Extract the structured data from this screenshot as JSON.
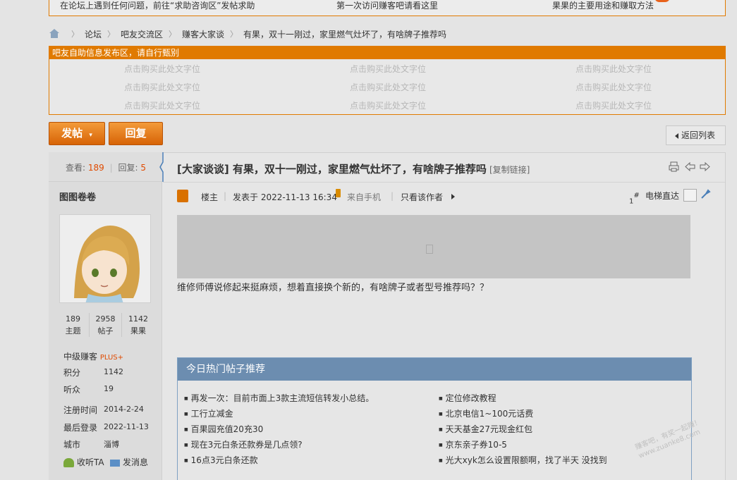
{
  "top_notice": {
    "left": "在论坛上遇到任何问题，前往“求助咨询区”发帖求助",
    "mid": "第一次访问赚客吧请看这里",
    "right": "果果的主要用途和赚取方法",
    "badge": "热"
  },
  "breadcrumb": [
    "论坛",
    "吧友交流区",
    "赚客大家谈",
    "有果，双十一刚过，家里燃气灶坏了，有啥牌子推荐吗"
  ],
  "ad": {
    "header": "吧友自助信息发布区，请自行甄别",
    "slot_text": "点击购买此处文字位"
  },
  "buttons": {
    "post": "发帖",
    "reply": "回复",
    "return": "返回列表"
  },
  "stats": {
    "views_label": "查看:",
    "views": "189",
    "replies_label": "回复:",
    "replies": "5"
  },
  "author": {
    "name": "图图卷卷",
    "counts": [
      {
        "value": "189",
        "label": "主题"
      },
      {
        "value": "2958",
        "label": "帖子"
      },
      {
        "value": "1142",
        "label": "果果"
      }
    ],
    "level": "中级赚客",
    "level_badge": "PLUS+",
    "points_label": "积分",
    "points": "1142",
    "fans_label": "听众",
    "fans": "19",
    "reg_label": "注册时间",
    "reg": "2014-2-24",
    "last_label": "最后登录",
    "last": "2022-11-13",
    "city_label": "城市",
    "city": "淄博",
    "follow": "收听TA",
    "message": "发消息"
  },
  "post": {
    "title": "[大家谈谈] 有果，双十一刚过，家里燃气灶坏了，有啥牌子推荐吗",
    "copy_link": "[复制链接]",
    "owner": "楼主",
    "posted": "发表于 2022-11-13 16:34",
    "source": "来自手机",
    "only_author": "只看该作者",
    "floor": "1",
    "floor_suffix": "#",
    "jump": "电梯直达",
    "content": "维修师傅说修起来挺麻烦，想着直接换个新的，有啥牌子或者型号推荐吗？？"
  },
  "hot": {
    "title": "今日热门帖子推荐",
    "left": [
      "再发一次：目前市面上3款主流短信转发小总结。",
      "工行立减金",
      "百果园充值20充30",
      "现在3元白条还款券是几点领?",
      "16点3元白条还款"
    ],
    "right": [
      "定位修改教程",
      "北京电信1~100元话费",
      "天天基金27元现金红包",
      "京东亲子券10-5",
      "光大xyk怎么设置限额啊，找了半天 没找到"
    ]
  },
  "watermark": [
    "赚客吧，有奖一起赚！",
    "www.zuanke8.com"
  ],
  "colors": {
    "accent": "#e07a00",
    "hot_header": "#6c8db0",
    "highlight": "#e04a00"
  }
}
